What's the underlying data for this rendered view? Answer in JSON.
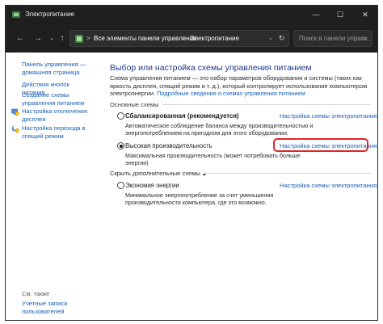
{
  "window": {
    "title": "Электропитание",
    "controls": {
      "minimize": "—",
      "maximize": "☐",
      "close": "✕"
    }
  },
  "navigation": {
    "back": "←",
    "forward": "→",
    "recent": "⌄",
    "up": "↑",
    "breadcrumb": [
      "Все элементы панели управления",
      "Электропитание"
    ],
    "breadcrumb_sep": ">",
    "address_dropdown": "⌄",
    "refresh": "↻",
    "search_placeholder": "Поиск в панели управ...",
    "search_icon": "⌕"
  },
  "sidebar": {
    "items": [
      {
        "label": "Панель управления — домашняя страница",
        "icon": null
      },
      {
        "label": "Действия кнопок питания",
        "icon": null
      },
      {
        "label": "Создание схемы управления питанием",
        "icon": null
      },
      {
        "label": "Настройка отключения дисплея",
        "icon": "display-shield-icon"
      },
      {
        "label": "Настройка перехода в спящий режим",
        "icon": "moon-shield-icon"
      }
    ],
    "see_also": {
      "heading": "См. также",
      "items": [
        {
          "label": "Учетные записи пользователей"
        }
      ]
    }
  },
  "main": {
    "title": "Выбор или настройка схемы управления питанием",
    "intro_text": "Схема управления питанием — это набор параметров оборудования и системы (таких как яркость дисплея, спящий режим и т. д.), который контролирует использование компьютером электроэнергии.",
    "intro_link": "Подробные сведения о схемах управления питанием",
    "preferred_section": "Основные схемы",
    "additional_section_toggle": "Скрыть дополнительные схемы",
    "plans": [
      {
        "name": "Сбалансированная (рекомендуется)",
        "description": "Автоматическое соблюдение баланса между производительностью и энергопотреблением на пригодном для этого оборудовании.",
        "link": "Настройка схемы электропитания",
        "selected": false
      },
      {
        "name": "Высокая производительность",
        "description": "Максимальная производительность (может потребовать больше энергии)",
        "link": "Настройка схемы электропитания",
        "selected": true
      },
      {
        "name": "Экономия энергии",
        "description": "Минимальное энергопотребление за счет уменьшения производительности компьютера, где это возможно.",
        "link": "Настройка схемы электропитания",
        "selected": false
      }
    ]
  },
  "colors": {
    "link": "#1a5fb4",
    "title": "#1e3a8a",
    "chrome": "#1f1f1f",
    "highlight": "#e0242b"
  }
}
